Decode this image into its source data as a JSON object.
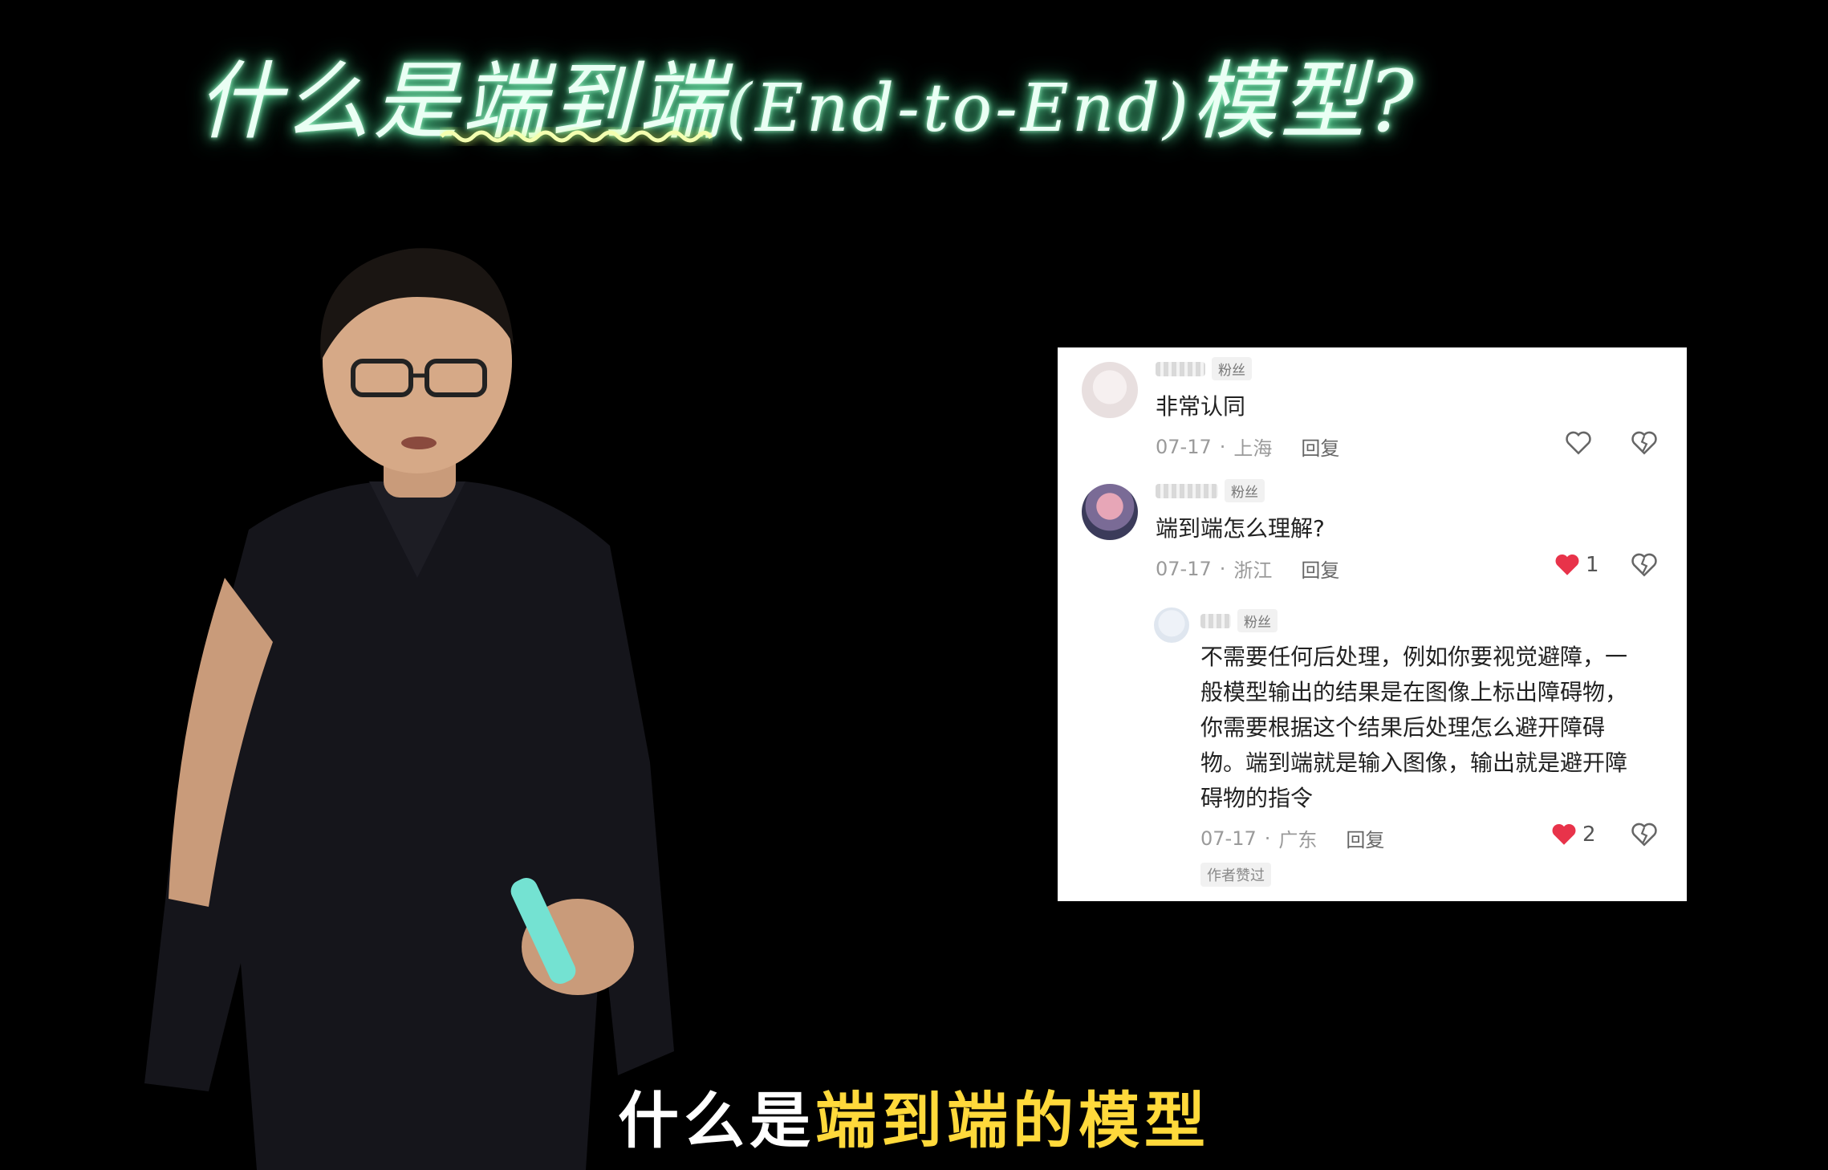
{
  "board": {
    "title_part1": "什么是",
    "title_highlight": "端到端",
    "title_part2": "(End-to-End)",
    "title_part3": "模型?"
  },
  "comments": [
    {
      "badge": "粉丝",
      "text": "非常认同",
      "date": "07-17",
      "location": "上海",
      "reply_label": "回复",
      "likes": ""
    },
    {
      "badge": "粉丝",
      "text": "端到端怎么理解?",
      "date": "07-17",
      "location": "浙江",
      "reply_label": "回复",
      "likes": "1"
    },
    {
      "badge": "粉丝",
      "text_lines": [
        "不需要任何后处理，例如你要视觉避障，一",
        "般模型输出的结果是在图像上标出障碍物，",
        "你需要根据这个结果后处理怎么避开障碍",
        "物。端到端就是输入图像，输出就是避开障",
        "碍物的指令"
      ],
      "date": "07-17",
      "location": "广东",
      "reply_label": "回复",
      "likes": "2",
      "author_liked": "作者赞过"
    }
  ],
  "subtitle": {
    "part1": "什么是",
    "accent": "端到端的模型"
  },
  "colors": {
    "like_active": "#e8334a",
    "subtitle_accent": "#ffd93b",
    "glow": "#5fe0a0"
  },
  "icons": [
    "heart-outline-icon",
    "heart-filled-icon",
    "dislike-icon"
  ]
}
